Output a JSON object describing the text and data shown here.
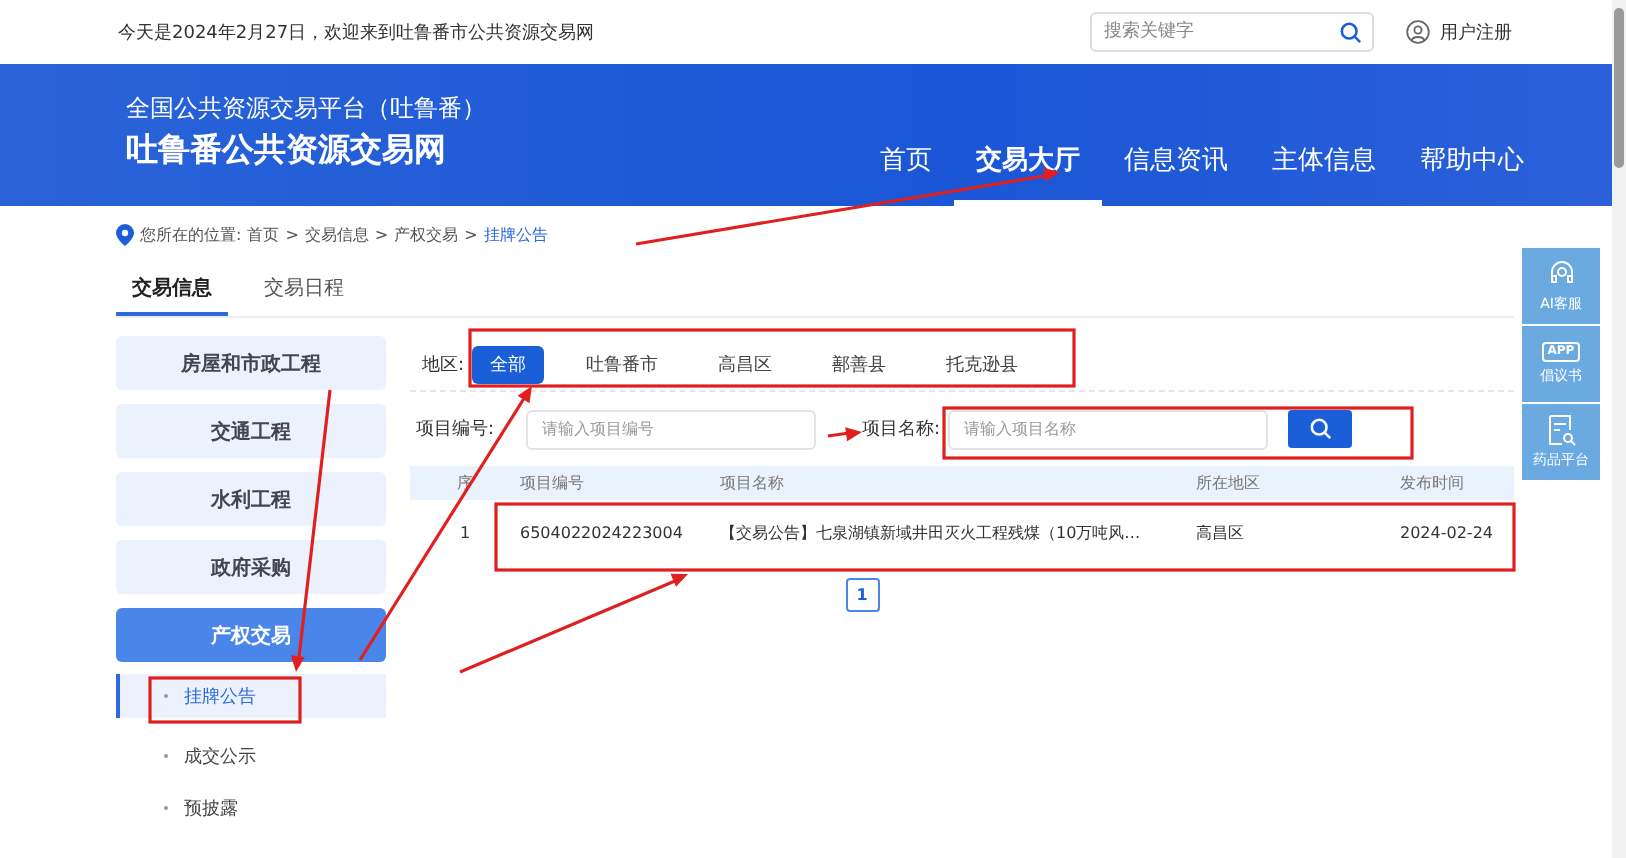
{
  "top_bar": {
    "greeting": "今天是2024年2月27日，欢迎来到吐鲁番市公共资源交易网",
    "search": {
      "placeholder": "搜索关键字"
    },
    "user_link": "用户注册"
  },
  "banner": {
    "subtitle": "全国公共资源交易平台（吐鲁番）",
    "title": "吐鲁番公共资源交易网"
  },
  "nav": [
    {
      "label": "首页",
      "selected": false
    },
    {
      "label": "交易大厅",
      "selected": true
    },
    {
      "label": "信息资讯",
      "selected": false
    },
    {
      "label": "主体信息",
      "selected": false
    },
    {
      "label": "帮助中心",
      "selected": false
    }
  ],
  "breadcrumb": {
    "prefix": "您所在的位置:",
    "items": [
      "首页",
      ">",
      "交易信息",
      ">",
      "产权交易",
      ">"
    ],
    "current": "挂牌公告"
  },
  "tabs": [
    {
      "label": "交易信息",
      "selected": true
    },
    {
      "label": "交易日程",
      "selected": false
    }
  ],
  "sidebar": {
    "items": [
      {
        "label": "房屋和市政工程",
        "selected": false
      },
      {
        "label": "交通工程",
        "selected": false
      },
      {
        "label": "水利工程",
        "selected": false
      },
      {
        "label": "政府采购",
        "selected": false
      },
      {
        "label": "产权交易",
        "selected": true,
        "children": [
          {
            "label": "挂牌公告",
            "selected": true
          },
          {
            "label": "成交公示",
            "selected": false
          },
          {
            "label": "预披露",
            "selected": false
          }
        ]
      }
    ]
  },
  "filters": {
    "region_label": "地区:",
    "regions": [
      {
        "label": "全部",
        "selected": true
      },
      {
        "label": "吐鲁番市",
        "selected": false
      },
      {
        "label": "高昌区",
        "selected": false
      },
      {
        "label": "鄯善县",
        "selected": false
      },
      {
        "label": "托克逊县",
        "selected": false
      }
    ],
    "code_label": "项目编号:",
    "code_placeholder": "请输入项目编号",
    "name_label": "项目名称:",
    "name_placeholder": "请输入项目名称"
  },
  "table": {
    "columns": [
      "序",
      "项目编号",
      "项目名称",
      "所在地区",
      "发布时间"
    ],
    "rows": [
      [
        "1",
        "6504022024223004",
        "【交易公告】七泉湖镇新域井田灭火工程残煤（10万吨风…",
        "高昌区",
        "2024-02-24"
      ]
    ]
  },
  "pagination": [
    {
      "label": "1",
      "selected": true
    }
  ],
  "side_tools": [
    {
      "kind": "headset",
      "label": "AI客服"
    },
    {
      "kind": "app",
      "icon_text": "APP",
      "label": "倡议书"
    },
    {
      "kind": "doc",
      "label": "药品平台"
    }
  ]
}
